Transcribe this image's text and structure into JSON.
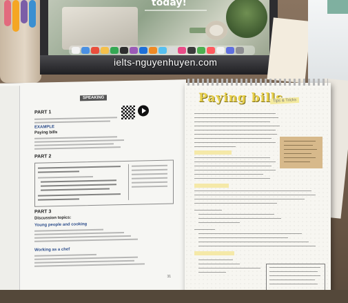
{
  "screen": {
    "headline": "today!"
  },
  "watermark": {
    "text": "ielts-nguyenhuyen.com"
  },
  "book": {
    "speaking_label": "SPEAKING",
    "part1": "PART 1",
    "part2": "PART 2",
    "part3": "PART 3",
    "example_label": "EXAMPLE",
    "topic1": "Paying bills",
    "discussion": "Discussion topics:",
    "topic2": "Young people and cooking",
    "topic3": "Working as a chef",
    "page_number": "31"
  },
  "notebook": {
    "title": "Paying bills",
    "tag": "Tips & Tricks"
  },
  "colors": {
    "highlighter": "#f4e69b",
    "title_yellow": "#e9d14a",
    "postit": "#d7b98b"
  }
}
